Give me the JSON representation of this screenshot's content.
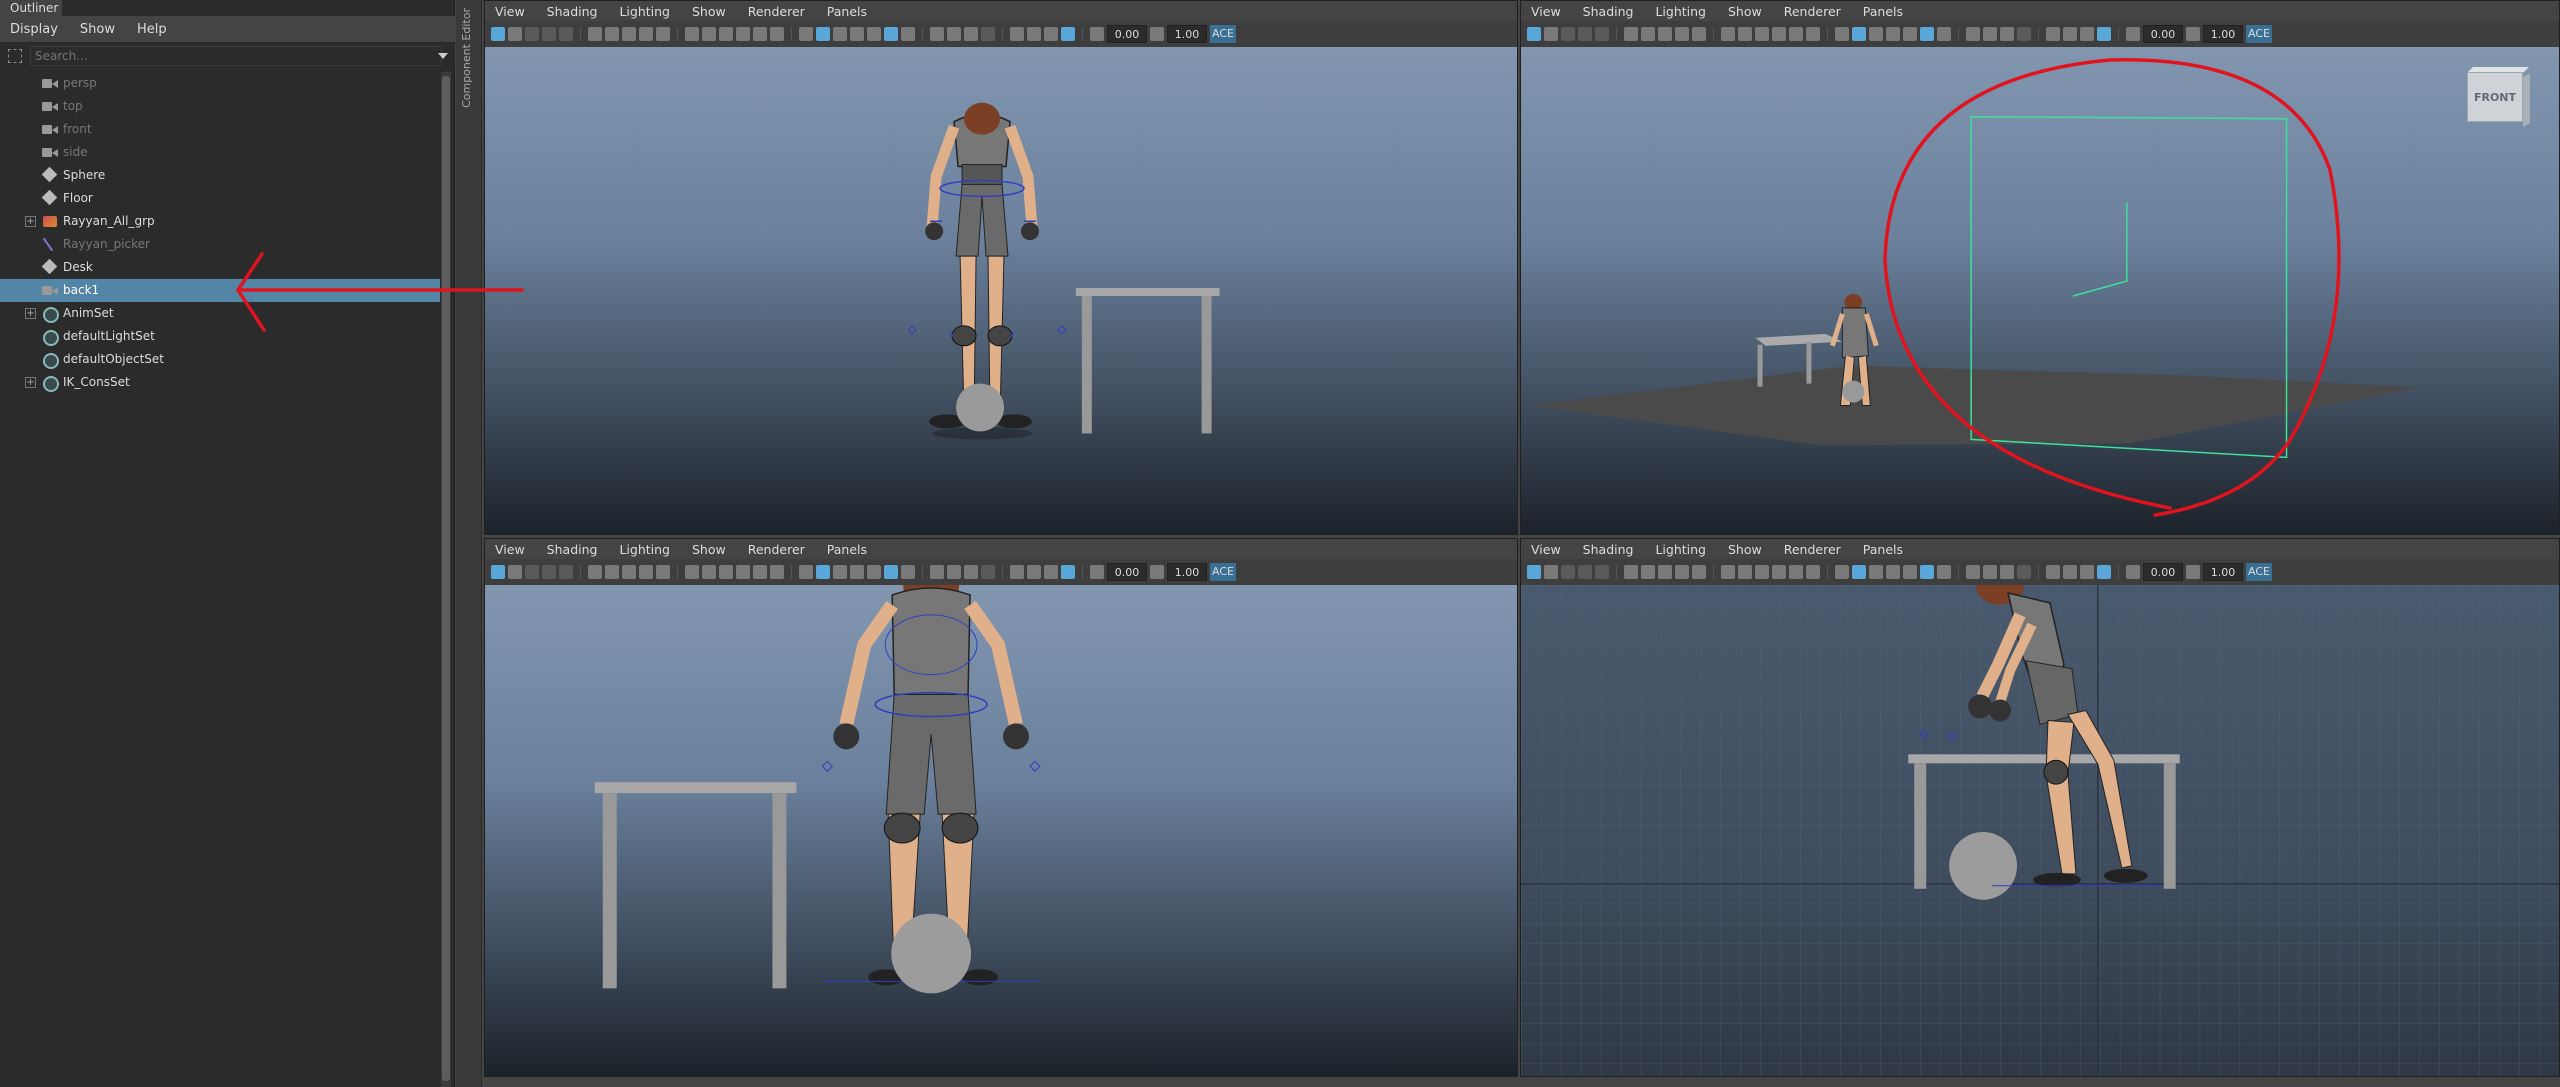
{
  "outliner": {
    "tab_label": "Outliner",
    "menu": [
      "Display",
      "Show",
      "Help"
    ],
    "search_placeholder": "Search...",
    "items": [
      {
        "label": "persp",
        "icon": "camera-icon",
        "dim": true,
        "expandable": false,
        "selected": false
      },
      {
        "label": "top",
        "icon": "camera-icon",
        "dim": true,
        "expandable": false,
        "selected": false
      },
      {
        "label": "front",
        "icon": "camera-icon",
        "dim": true,
        "expandable": false,
        "selected": false
      },
      {
        "label": "side",
        "icon": "camera-icon",
        "dim": true,
        "expandable": false,
        "selected": false
      },
      {
        "label": "Sphere",
        "icon": "mesh-icon",
        "dim": false,
        "expandable": false,
        "selected": false
      },
      {
        "label": "Floor",
        "icon": "mesh-icon",
        "dim": false,
        "expandable": false,
        "selected": false
      },
      {
        "label": "Rayyan_All_grp",
        "icon": "group-icon",
        "dim": false,
        "expandable": true,
        "selected": false
      },
      {
        "label": "Rayyan_picker",
        "icon": "picker-icon",
        "dim": true,
        "expandable": false,
        "selected": false
      },
      {
        "label": "Desk",
        "icon": "mesh-icon",
        "dim": false,
        "expandable": false,
        "selected": false
      },
      {
        "label": "back1",
        "icon": "camera-icon",
        "dim": false,
        "expandable": false,
        "selected": true
      },
      {
        "label": "AnimSet",
        "icon": "set-icon",
        "dim": false,
        "expandable": true,
        "selected": false
      },
      {
        "label": "defaultLightSet",
        "icon": "set-icon",
        "dim": false,
        "expandable": false,
        "selected": false
      },
      {
        "label": "defaultObjectSet",
        "icon": "set-icon",
        "dim": false,
        "expandable": false,
        "selected": false
      },
      {
        "label": "IK_ConsSet",
        "icon": "set-icon",
        "dim": false,
        "expandable": true,
        "selected": false
      }
    ]
  },
  "component_editor": {
    "label": "Component Editor"
  },
  "viewport": {
    "menu": [
      "View",
      "Shading",
      "Lighting",
      "Show",
      "Renderer",
      "Panels"
    ],
    "exposure": "0.00",
    "gamma": "1.00",
    "color_space": "ACE"
  },
  "viewcube": {
    "label": "FRONT"
  },
  "colors": {
    "selection": "#5285a6",
    "annotation": "#e0141e",
    "camera_frustum": "#3fe09a",
    "rig_control": "#2f3fbf"
  }
}
